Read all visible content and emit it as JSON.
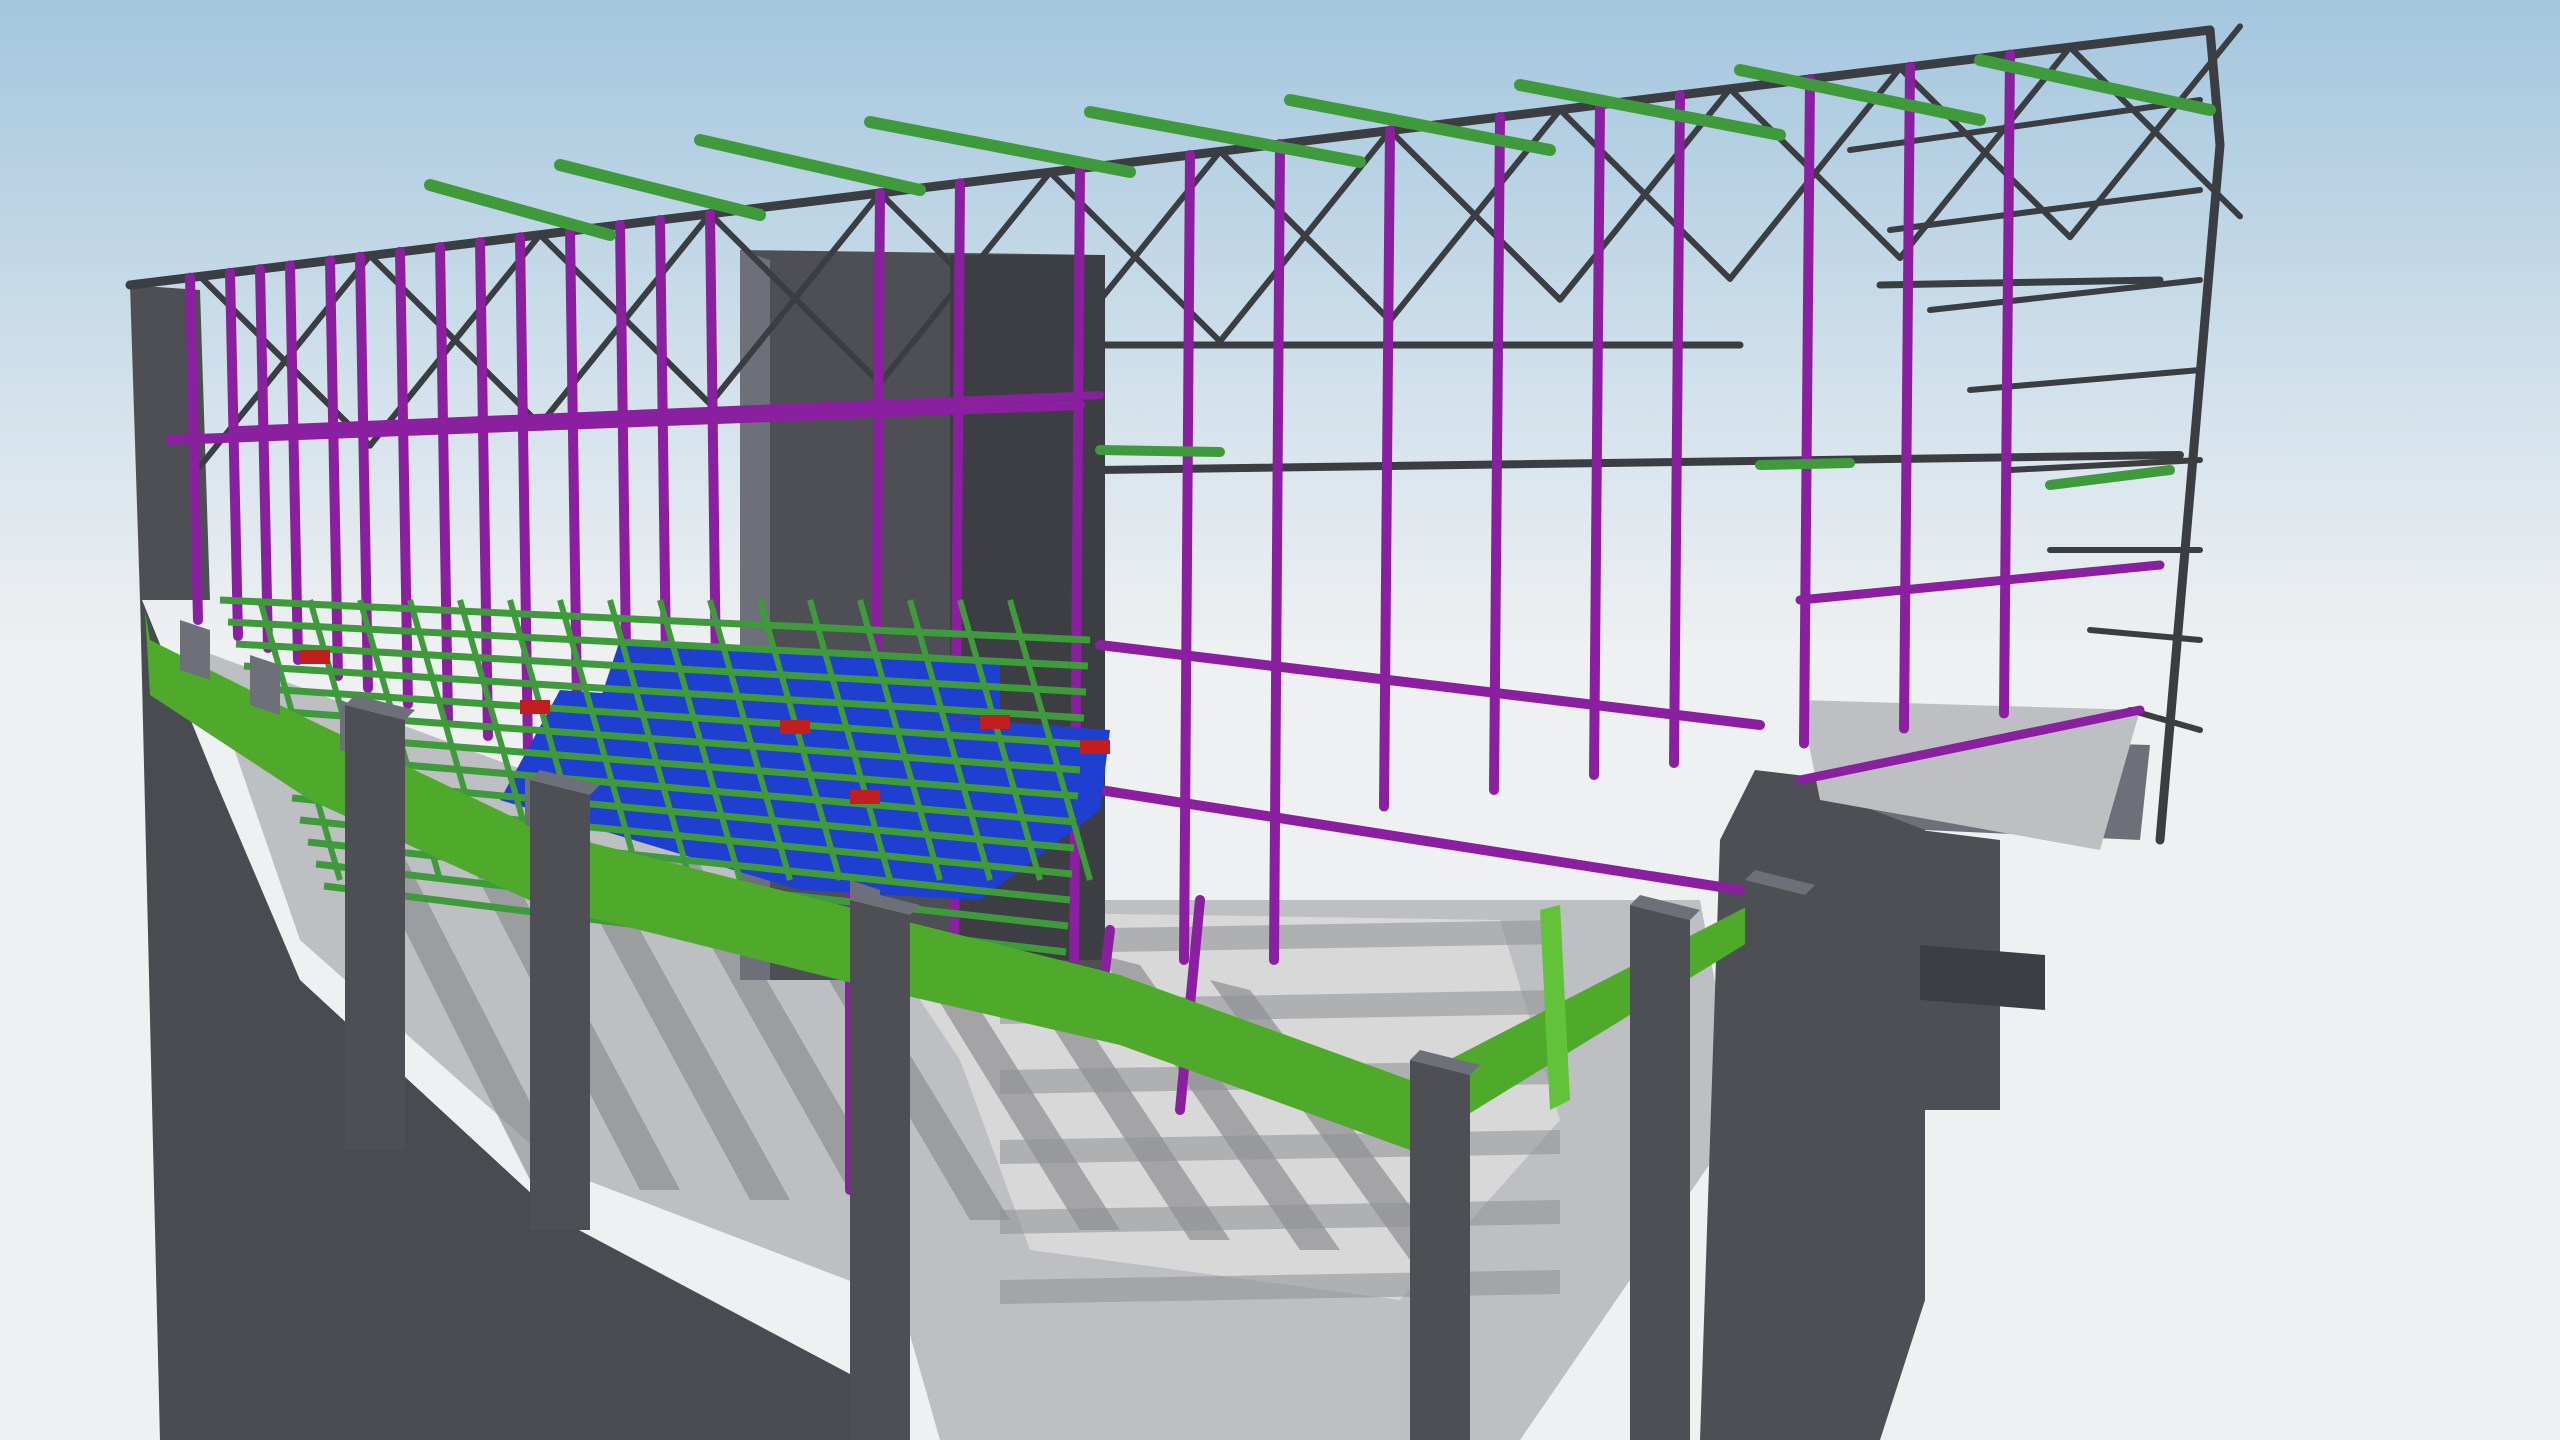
{
  "viewport": {
    "render_mode": "shaded-3d",
    "projection": "perspective",
    "background": "sky-gradient"
  },
  "palette": {
    "sky_top": "#a4c6de",
    "sky_mid": "#d4e2ec",
    "horizon": "#eef0f1",
    "concrete": "#4d4f55",
    "concrete_light": "#6d7078",
    "concrete_dark": "#3c3e43",
    "slab": "#bdbfc2",
    "slab_light": "#d8d8d8",
    "shadow": "#8e8f93",
    "steel_purple": "#8a1fa0",
    "steel_purple_dark": "#5a1370",
    "steel_green": "#3f9a3c",
    "steel_green_light": "#62c23a",
    "brace_grey": "#3a3d42",
    "deck_blue": "#1e3fd0",
    "accent_red": "#c21e1e",
    "edge_beam_green": "#4faa2b"
  },
  "layers": [
    {
      "name": "concrete-core",
      "color": "concrete"
    },
    {
      "name": "roof-truss",
      "color": "brace_grey"
    },
    {
      "name": "purple-columns",
      "color": "steel_purple"
    },
    {
      "name": "green-beams",
      "color": "steel_green"
    },
    {
      "name": "blue-deck",
      "color": "deck_blue"
    },
    {
      "name": "edge-beam",
      "color": "edge_beam_green"
    }
  ]
}
